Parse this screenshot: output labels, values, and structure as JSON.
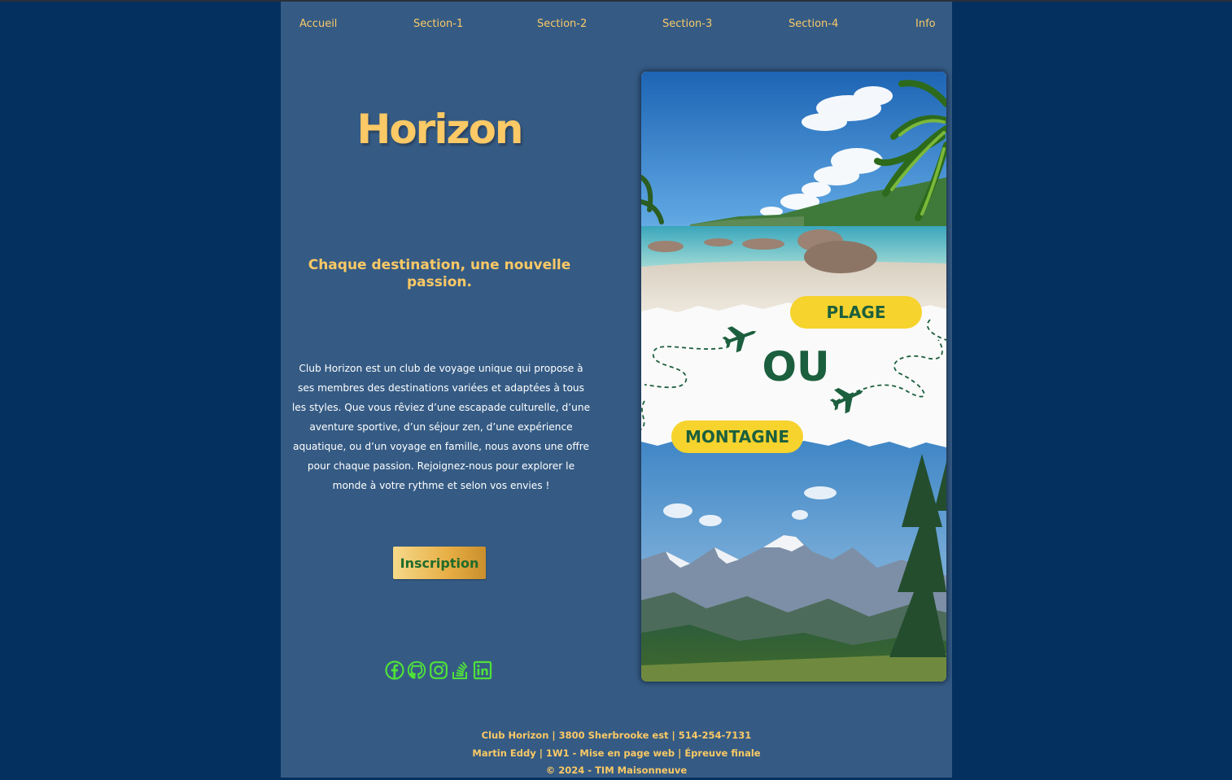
{
  "nav": {
    "items": [
      "Accueil",
      "Section-1",
      "Section-2",
      "Section-3",
      "Section-4",
      "Info"
    ]
  },
  "hero": {
    "title": "Horizon",
    "tagline": "Chaque destination, une nouvelle passion.",
    "description": "Club Horizon est un club de voyage unique qui propose à ses membres des destinations variées et adaptées à tous les styles. Que vous rêviez d’une escapade culturelle, d’une aventure sportive, d’un séjour zen, d’une expérience aquatique, ou d’un voyage en famille, nous avons une offre pour chaque passion. Rejoignez-nous pour explorer le monde à votre rythme et selon vos envies !",
    "button_label": "Inscription"
  },
  "socials": [
    "facebook-icon",
    "github-icon",
    "instagram-icon",
    "stackoverflow-icon",
    "linkedin-icon"
  ],
  "card": {
    "pill_top": "PLAGE",
    "middle": "OU",
    "pill_bottom": "MONTAGNE"
  },
  "footer": {
    "line1": "Club Horizon | 3800 Sherbrooke est | 514-254-7131",
    "line2": "Martin Eddy | 1W1 - Mise en page web | Épreuve finale",
    "line3": "© 2024 - TIM Maisonneuve"
  },
  "colors": {
    "background": "#03305f",
    "panel": "#355b84",
    "accent_gold": "#fbc965",
    "social_green": "#4fe23a",
    "pill_yellow": "#f6d32d",
    "dark_green": "#1c5f3e"
  }
}
